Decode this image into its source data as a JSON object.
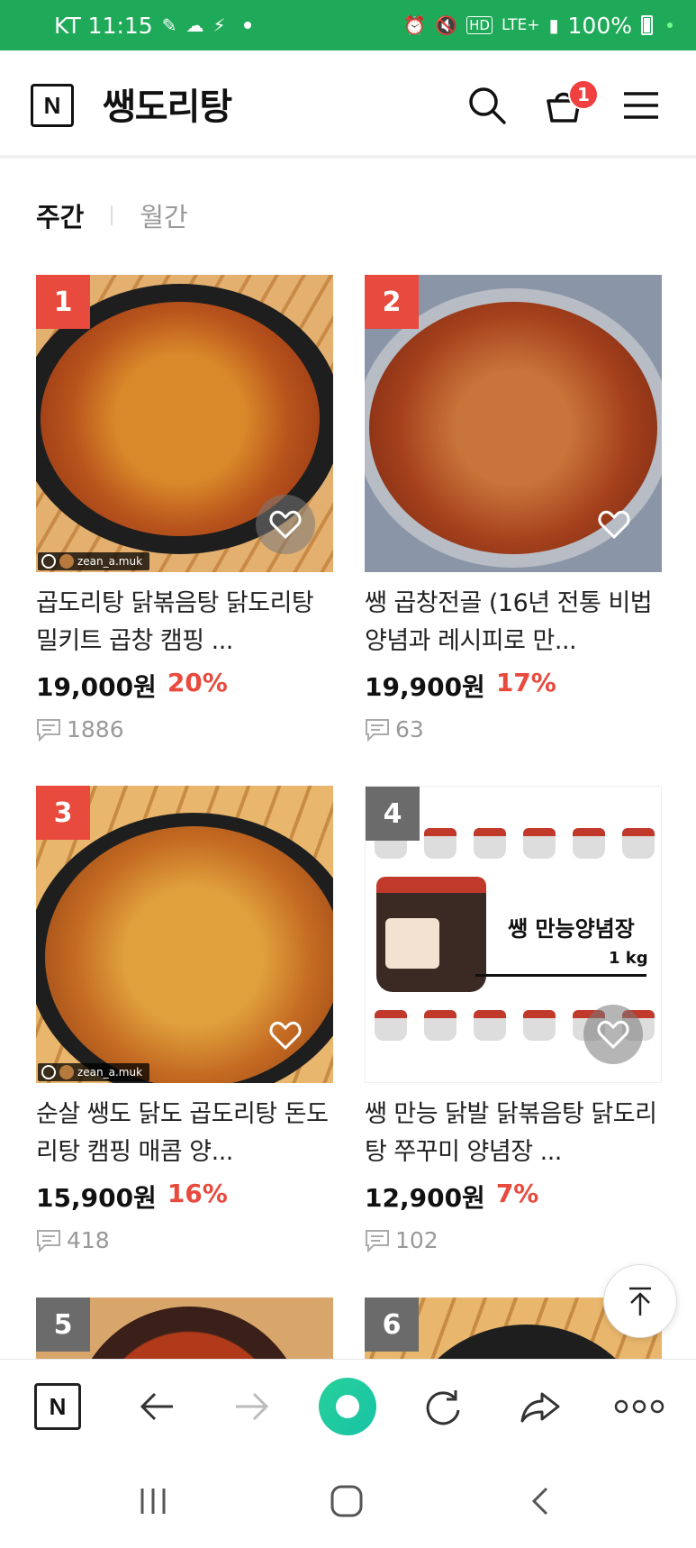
{
  "status_bar": {
    "carrier_time": "KT 11:15",
    "network": "LTE+",
    "hd": "HD",
    "battery": "100%"
  },
  "header": {
    "logo": "N",
    "title": "쌩도리탕",
    "cart_count": "1"
  },
  "tabs": {
    "weekly": "주간",
    "monthly": "월간"
  },
  "products": [
    {
      "rank": "1",
      "title": "곱도리탕 닭볶음탕 닭도리탕 밀키트 곱창 캠핑 ...",
      "price": "19,000원",
      "discount": "20%",
      "reviews": "1886",
      "uploader": "zean_a.muk"
    },
    {
      "rank": "2",
      "title": "쌩 곱창전골 (16년 전통 비법양념과 레시피로 만...",
      "price": "19,900원",
      "discount": "17%",
      "reviews": "63"
    },
    {
      "rank": "3",
      "title": "순살 쌩도 닭도 곱도리탕 돈도리탕 캠핑 매콤 양...",
      "price": "15,900원",
      "discount": "16%",
      "reviews": "418",
      "uploader": "zean_a.muk"
    },
    {
      "rank": "4",
      "title": "쌩 만능 닭발 닭볶음탕 닭도리탕 쭈꾸미 양념장 ...",
      "price": "12,900원",
      "discount": "7%",
      "reviews": "102",
      "image_text": "쌩 만능양념장",
      "image_sub": "1 kg"
    },
    {
      "rank": "5"
    },
    {
      "rank": "6"
    }
  ],
  "bottom_bar": {
    "logo": "N"
  },
  "colors": {
    "status_green": "#1faa59",
    "rank_red": "#e84a3e",
    "rank_grey": "#6b6b6b",
    "discount_red": "#e84a3e"
  }
}
